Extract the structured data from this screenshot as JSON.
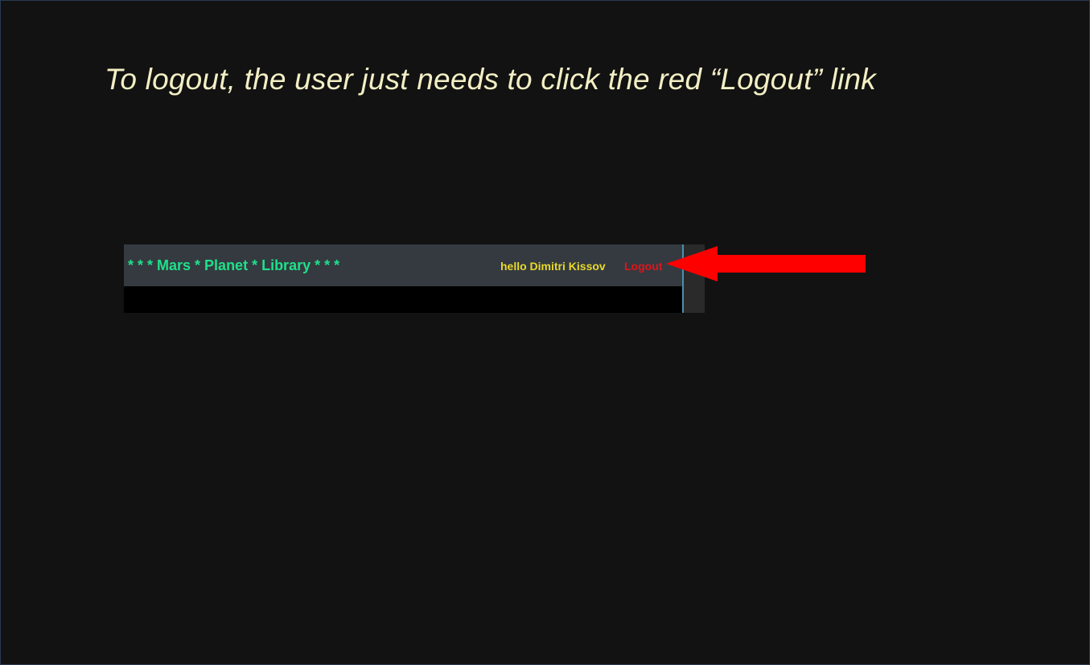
{
  "caption": "To logout, the user just needs to click the red “Logout” link",
  "navbar": {
    "brand": "* * * Mars * Planet * Library * * *",
    "greeting": "hello Dimitri Kissov",
    "logout_label": "Logout"
  },
  "colors": {
    "background": "#121212",
    "caption": "#f3efc4",
    "navbar_bg": "#343a40",
    "brand": "#1fe08a",
    "greeting": "#e8d92a",
    "logout": "#e0141a",
    "arrow": "#ff0000"
  },
  "annotation": {
    "arrow_icon": "left-arrow-icon"
  }
}
